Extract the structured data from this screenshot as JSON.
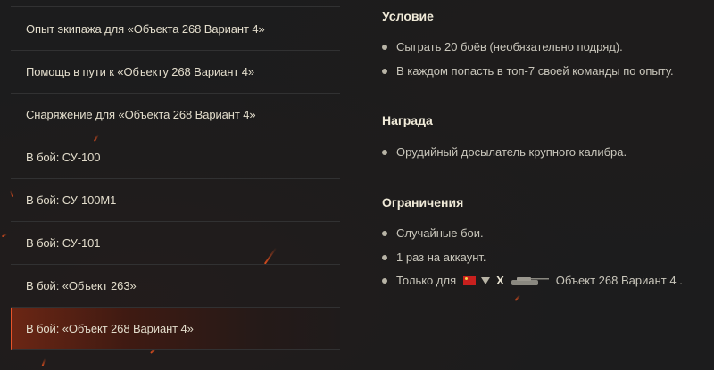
{
  "mission_list": {
    "items": [
      {
        "label": "Опыт экипажа для «Объекта 268 Вариант 4»",
        "active": false
      },
      {
        "label": "Помощь в пути к «Объекту 268 Вариант 4»",
        "active": false
      },
      {
        "label": "Снаряжение для «Объекта 268 Вариант 4»",
        "active": false
      },
      {
        "label": "В бой: СУ-100",
        "active": false
      },
      {
        "label": "В бой: СУ-100М1",
        "active": false
      },
      {
        "label": "В бой: СУ-101",
        "active": false
      },
      {
        "label": "В бой: «Объект 263»",
        "active": false
      },
      {
        "label": "В бой: «Объект 268 Вариант 4»",
        "active": true
      }
    ]
  },
  "details": {
    "condition": {
      "title": "Условие",
      "items": [
        "Сыграть 20 боёв (необязательно подряд).",
        "В каждом попасть в топ-7 своей команды по опыту."
      ]
    },
    "reward": {
      "title": "Награда",
      "items": [
        "Орудийный досылатель крупного калибра."
      ]
    },
    "restrictions": {
      "title": "Ограничения",
      "items": [
        "Случайные бои.",
        "1 раз на аккаунт."
      ],
      "vehicle_line": {
        "prefix": "Только для",
        "nation_icon": "ussr-flag-icon",
        "class_icon": "tank-destroyer-icon",
        "tier": "X",
        "vehicle_icon": "tank-silhouette-icon",
        "vehicle_name": "Объект 268 Вариант 4 ."
      }
    }
  },
  "colors": {
    "background": "#1c1c1d",
    "accent": "#e8542a",
    "text_primary": "#e2dccb",
    "text_secondary": "#c9c6bb"
  }
}
